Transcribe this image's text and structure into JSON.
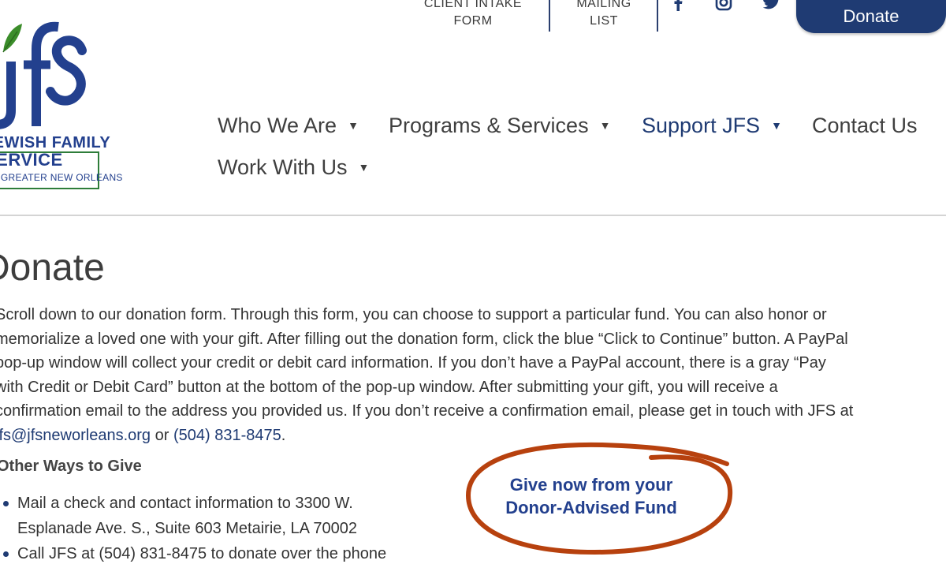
{
  "utility": {
    "client_intake": [
      "CLIENT INTAKE",
      "FORM"
    ],
    "mailing_list": [
      "MAILING",
      "LIST"
    ],
    "donate_label": "Donate"
  },
  "icons": {
    "facebook": "facebook-icon",
    "instagram": "instagram-icon",
    "twitter": "twitter-icon"
  },
  "logo": {
    "line1": "JEWISH FAMILY",
    "line2": "SERVICE",
    "line3": "OF GREATER NEW ORLEANS"
  },
  "nav": {
    "items": [
      {
        "label": "Who We Are"
      },
      {
        "label": "Programs & Services"
      },
      {
        "label": "Support JFS"
      },
      {
        "label": "Contact Us"
      },
      {
        "label": "Work With Us"
      }
    ]
  },
  "colors": {
    "brand_blue": "#1f3b73",
    "brand_green": "#2e7d3a",
    "annotation_red": "#b7410e"
  },
  "content": {
    "title": "Donate",
    "intro_lines": [
      "Scroll down to our donation form. Through this form, you can choose to support a particular fund. You can also honor or",
      "memorialize a loved one with your gift. After filling out the donation form, click the blue “Click to Continue” button. A PayPal",
      "pop-up window will collect your credit or debit card information. If you don’t have a PayPal account, there is a gray “Pay",
      "with Credit or Debit Card” button at the bottom of the pop-up window. After submitting your gift, you will receive a",
      "confirmation email to the address you provided us. If you don’t receive a confirmation email, please get in touch with JFS at"
    ],
    "email": "jfs@jfsneworleans.org",
    "or_text": " or ",
    "phone": "(504) 831-8475",
    "period": ".",
    "ways_title": "Other Ways to Give",
    "ways": [
      "Mail a check and contact information to 3300 W. Esplanade Ave. S., Suite 603 Metairie, LA 70002",
      "Call JFS at (504) 831-8475 to donate over the phone"
    ],
    "daf_link": [
      "Give now from your",
      "Donor-Advised Fund"
    ]
  }
}
